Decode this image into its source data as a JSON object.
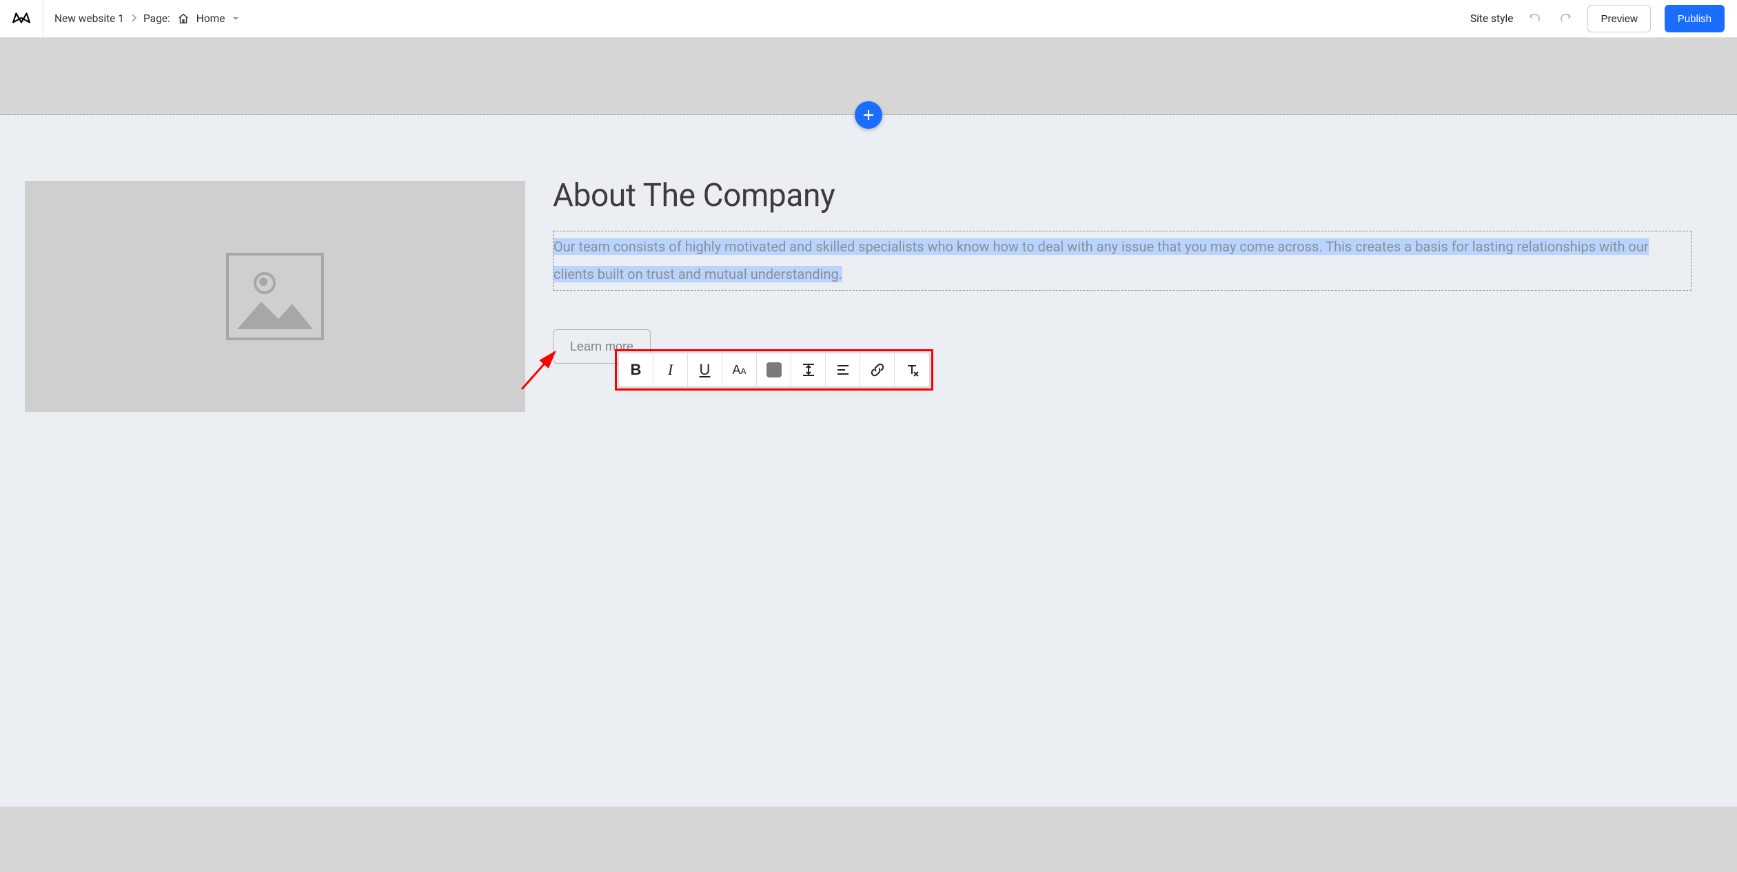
{
  "toolbar": {
    "site_name": "New website 1",
    "page_label": "Page:",
    "page_name": "Home",
    "site_style": "Site style",
    "preview": "Preview",
    "publish": "Publish"
  },
  "content": {
    "heading": "About The Company",
    "paragraph": "Our team consists of highly motivated and skilled specialists who know how to deal with any issue that you may come across. This creates a basis for lasting relationships with our clients built on trust and mutual understanding.",
    "button": "Learn more"
  },
  "rt_toolbar": {
    "bold": "B",
    "italic": "I",
    "underline": "U"
  }
}
